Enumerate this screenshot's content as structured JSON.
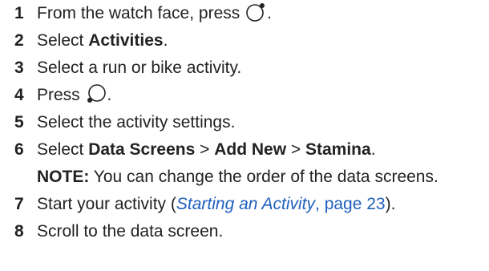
{
  "steps": [
    {
      "number": "1",
      "text": "From the watch face, press",
      "icon": "watch-button-top-right-icon",
      "after": "."
    },
    {
      "number": "2",
      "pre": "Select ",
      "bold": "Activities",
      "after": "."
    },
    {
      "number": "3",
      "text": "Select a run or bike activity."
    },
    {
      "number": "4",
      "text": "Press",
      "icon": "watch-button-bottom-left-icon",
      "after": "."
    },
    {
      "number": "5",
      "text": "Select the activity settings."
    },
    {
      "number": "6",
      "pre": "Select ",
      "bold1": "Data Screens",
      "sep1": " > ",
      "bold2": "Add New",
      "sep2": " > ",
      "bold3": "Stamina",
      "after": "."
    },
    {
      "note_label": "NOTE:",
      "note_text": " You can change the order of the data screens."
    },
    {
      "number": "7",
      "pre": "Start your activity (",
      "link": "Starting an Activity",
      "comma": ", ",
      "page": "page 23",
      "after": ")."
    },
    {
      "number": "8",
      "text": "Scroll to the data screen."
    }
  ]
}
